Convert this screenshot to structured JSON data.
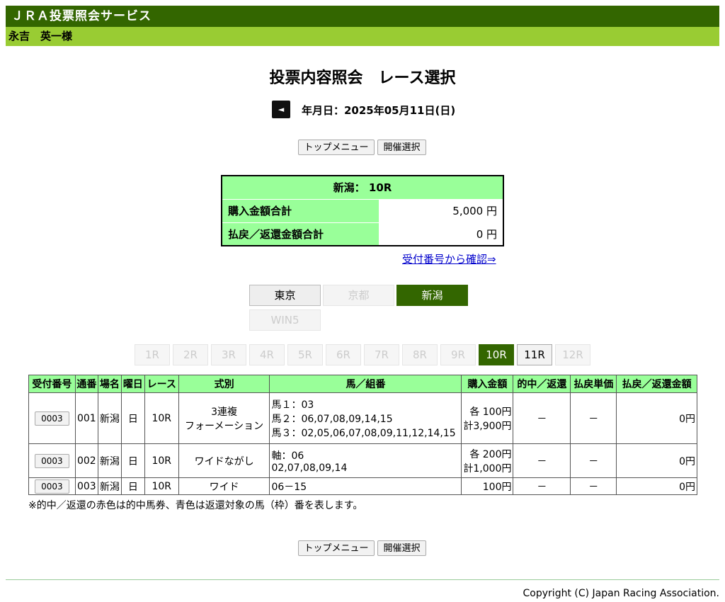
{
  "header": {
    "service_title": "ＪＲＡ投票照会サービス",
    "user_name": "永吉　英一様"
  },
  "page_title": "投票内容照会　レース選択",
  "date": {
    "prev_icon": "◄",
    "label": "年月日：2025年05月11日(日)"
  },
  "nav": {
    "top_menu": "トップメニュー",
    "venue_select": "開催選択"
  },
  "summary": {
    "header": "新潟： 10R",
    "rows": [
      {
        "label": "購入金額合計",
        "value": "5,000 円"
      },
      {
        "label": "払戻／返還金額合計",
        "value": "0 円"
      }
    ]
  },
  "confirm_link": "受付番号から確認⇒",
  "venues": [
    {
      "label": "東京",
      "state": "enabled"
    },
    {
      "label": "京都",
      "state": "disabled"
    },
    {
      "label": "新潟",
      "state": "active"
    },
    {
      "label": "WIN5",
      "state": "disabled"
    }
  ],
  "races": [
    {
      "label": "1R",
      "state": "disabled"
    },
    {
      "label": "2R",
      "state": "disabled"
    },
    {
      "label": "3R",
      "state": "disabled"
    },
    {
      "label": "4R",
      "state": "disabled"
    },
    {
      "label": "5R",
      "state": "disabled"
    },
    {
      "label": "6R",
      "state": "disabled"
    },
    {
      "label": "7R",
      "state": "disabled"
    },
    {
      "label": "8R",
      "state": "disabled"
    },
    {
      "label": "9R",
      "state": "disabled"
    },
    {
      "label": "10R",
      "state": "active"
    },
    {
      "label": "11R",
      "state": "enabled"
    },
    {
      "label": "12R",
      "state": "disabled"
    }
  ],
  "table": {
    "headers": [
      "受付番号",
      "通番",
      "場名",
      "曜日",
      "レース",
      "式別",
      "馬／組番",
      "購入金額",
      "的中／返還",
      "払戻単価",
      "払戻／返還金額"
    ],
    "rows": [
      {
        "receipt": "0003",
        "seq": "001",
        "venue": "新潟",
        "day": "日",
        "race": "10R",
        "bet_type": [
          "3連複",
          "フォーメーション"
        ],
        "combo": [
          "馬１：03",
          "馬２：06,07,08,09,14,15",
          "馬３：02,05,06,07,08,09,11,12,14,15"
        ],
        "amount": [
          "各 100円",
          "計3,900円"
        ],
        "hit": "－",
        "unit": "－",
        "payout": "0円"
      },
      {
        "receipt": "0003",
        "seq": "002",
        "venue": "新潟",
        "day": "日",
        "race": "10R",
        "bet_type": [
          "ワイドながし"
        ],
        "combo": [
          "軸：06",
          "02,07,08,09,14"
        ],
        "amount": [
          "各 200円",
          "計1,000円"
        ],
        "hit": "－",
        "unit": "－",
        "payout": "0円"
      },
      {
        "receipt": "0003",
        "seq": "003",
        "venue": "新潟",
        "day": "日",
        "race": "10R",
        "bet_type": [
          "ワイド"
        ],
        "combo": [
          "06－15"
        ],
        "amount": [
          "100円"
        ],
        "hit": "－",
        "unit": "－",
        "payout": "0円"
      }
    ]
  },
  "note": "※的中／返還の赤色は的中馬券、青色は返還対象の馬（枠）番を表します。",
  "copyright": "Copyright (C) Japan Racing Association.",
  "colors": {
    "header_bg": "#336600",
    "subheader_bg": "#99cc33",
    "table_header_bg": "#99ff99",
    "active_bg": "#336600"
  }
}
